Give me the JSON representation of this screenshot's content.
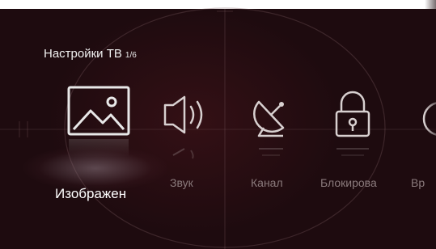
{
  "menu": {
    "title": "Настройки ТВ",
    "page_indicator": "1/6",
    "items": [
      {
        "label": "Изображен",
        "icon": "picture-icon",
        "selected": true
      },
      {
        "label": "Звук",
        "icon": "speaker-icon",
        "selected": false
      },
      {
        "label": "Канал",
        "icon": "satellite-dish-icon",
        "selected": false
      },
      {
        "label": "Блокирова",
        "icon": "lock-icon",
        "selected": false
      },
      {
        "label": "Вр",
        "icon": "clock-icon",
        "selected": false
      }
    ]
  },
  "colors": {
    "background": "#1e0b0f",
    "selected_text": "#ffffff",
    "inactive_text": "#8a7a7c"
  }
}
